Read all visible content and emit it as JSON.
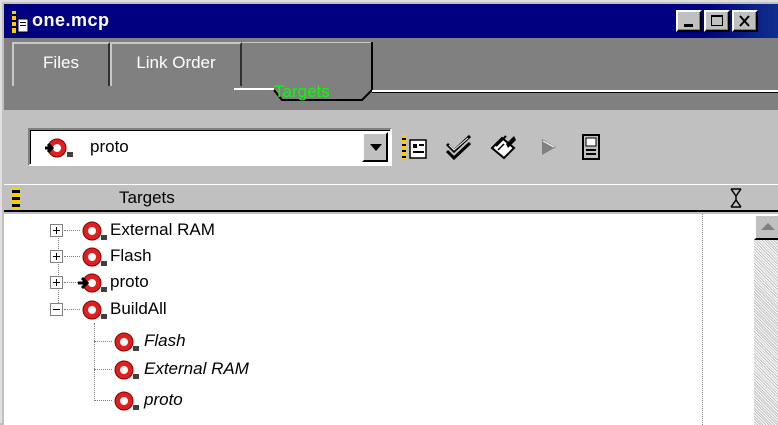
{
  "window": {
    "title": "one.mcp"
  },
  "tabs": [
    {
      "label": "Files",
      "active": false
    },
    {
      "label": "Link Order",
      "active": false
    },
    {
      "label": "Targets",
      "active": true
    }
  ],
  "toolbar": {
    "target_select_value": "proto",
    "tools": [
      "target-settings-icon",
      "check-syntax-icon",
      "make-icon",
      "run-icon",
      "debug-icon"
    ]
  },
  "list": {
    "header": "Targets",
    "items": [
      {
        "label": "External RAM",
        "expandable": true,
        "expanded": false,
        "current": false,
        "linked": false
      },
      {
        "label": "Flash",
        "expandable": true,
        "expanded": false,
        "current": false,
        "linked": false
      },
      {
        "label": "proto",
        "expandable": true,
        "expanded": false,
        "current": true,
        "linked": false
      },
      {
        "label": "BuildAll",
        "expandable": true,
        "expanded": true,
        "current": false,
        "linked": false,
        "children": [
          {
            "label": "Flash",
            "linked": true
          },
          {
            "label": "External RAM",
            "linked": true
          },
          {
            "label": "proto",
            "linked": true
          }
        ]
      }
    ]
  },
  "colors": {
    "title_bar": "#000080",
    "active_tab_text": "#00ff00",
    "target_icon": "#e02020",
    "face": "#c0c0c0"
  }
}
